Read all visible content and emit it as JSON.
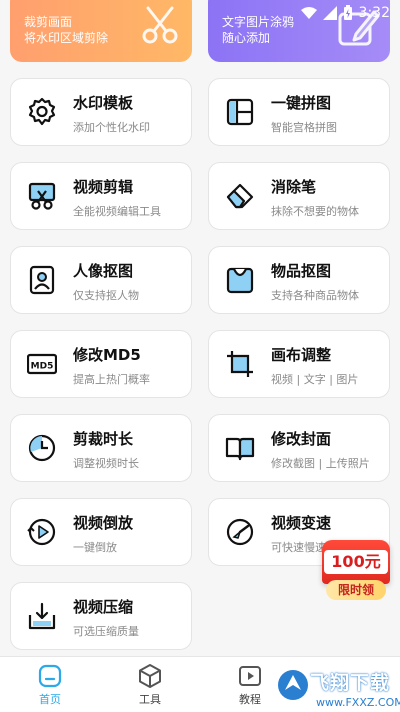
{
  "status": {
    "time": "3:32"
  },
  "banners": [
    {
      "lines": [
        "裁剪画面",
        "将水印区域剪除"
      ]
    },
    {
      "lines": [
        "文字图片涂鸦",
        "随心添加"
      ]
    }
  ],
  "cards": [
    {
      "title": "水印模板",
      "sub": "添加个性化水印",
      "icon": "gear-icon"
    },
    {
      "title": "一键拼图",
      "sub": "智能宫格拼图",
      "icon": "collage-icon"
    },
    {
      "title": "视频剪辑",
      "sub": "全能视频编辑工具",
      "icon": "scissors-icon"
    },
    {
      "title": "消除笔",
      "sub": "抹除不想要的物体",
      "icon": "eraser-icon"
    },
    {
      "title": "人像抠图",
      "sub": "仅支持抠人物",
      "icon": "portrait-icon"
    },
    {
      "title": "物品抠图",
      "sub": "支持各种商品物体",
      "icon": "bag-icon"
    },
    {
      "title": "修改MD5",
      "sub": "提高上热门概率",
      "icon": "md5-icon"
    },
    {
      "title": "画布调整",
      "sub": "视频 | 文字 | 图片",
      "icon": "crop-icon"
    },
    {
      "title": "剪裁时长",
      "sub": "调整视频时长",
      "icon": "clock-icon"
    },
    {
      "title": "修改封面",
      "sub": "修改截图 | 上传照片",
      "icon": "book-icon"
    },
    {
      "title": "视频倒放",
      "sub": "一键倒放",
      "icon": "rewind-icon"
    },
    {
      "title": "视频变速",
      "sub": "可快速慢速",
      "icon": "speed-icon"
    },
    {
      "title": "视频压缩",
      "sub": "可选压缩质量",
      "icon": "compress-icon"
    }
  ],
  "promo": {
    "amount": "100元",
    "tag": "限时领"
  },
  "tabs": [
    {
      "label": "首页",
      "icon": "home-icon"
    },
    {
      "label": "工具",
      "icon": "cube-icon"
    },
    {
      "label": "教程",
      "icon": "play-icon"
    }
  ],
  "watermark": {
    "brand": "飞翔下载",
    "url": "www.FXXZ.COM"
  },
  "colors": {
    "accent": "#2ba9e8",
    "banner_orange": "#ffa86a",
    "banner_purple": "#9a80f6",
    "promo_red": "#e02a20"
  }
}
